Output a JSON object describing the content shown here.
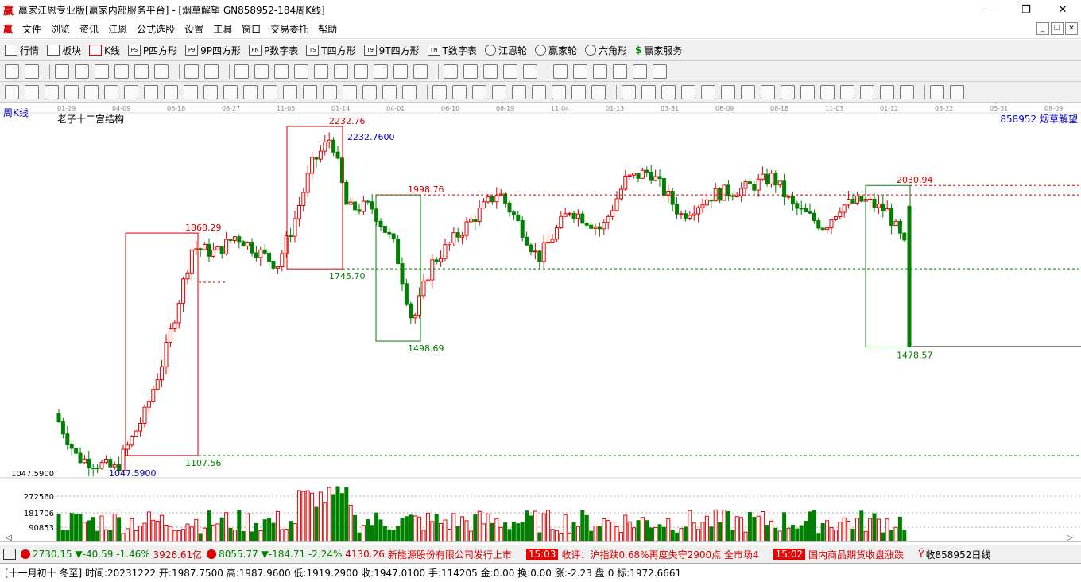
{
  "window": {
    "title": "赢家江恩专业版[赢家内部服务平台] - [烟草解望  GN858952-184周K线]",
    "logo": "赢"
  },
  "menu": [
    "文件",
    "浏览",
    "资讯",
    "江恩",
    "公式选股",
    "设置",
    "工具",
    "窗口",
    "交易委托",
    "帮助"
  ],
  "nav": [
    {
      "icon": "table-icon",
      "label": "行情"
    },
    {
      "icon": "grid-icon",
      "label": "板块"
    },
    {
      "icon": "candle-icon",
      "label": "K线"
    },
    {
      "icon": "ps-icon",
      "label": "P四方形"
    },
    {
      "icon": "9p-icon",
      "label": "9P四方形"
    },
    {
      "icon": "pn-icon",
      "label": "P数字表"
    },
    {
      "icon": "ts-icon",
      "label": "T四方形"
    },
    {
      "icon": "t9-icon",
      "label": "9T四方形"
    },
    {
      "icon": "tn-icon",
      "label": "T数字表"
    },
    {
      "icon": "wheel-icon",
      "label": "江恩轮"
    },
    {
      "icon": "wheel-icon",
      "label": "赢家轮"
    },
    {
      "icon": "hexagon-icon",
      "label": "六角形"
    },
    {
      "icon": "dollar-icon",
      "label": "赢家服务"
    }
  ],
  "chart_header": {
    "period_label": "周K线",
    "indicator_name": "老子十二宫结构",
    "code_name": "858952  烟草解望",
    "min_price_label": "1047.5900"
  },
  "chart_data": {
    "type": "candlestick",
    "x_ticks": [
      "01-29",
      "04-09",
      "06-18",
      "08-27",
      "11-05",
      "01-14",
      "04-01",
      "06-10",
      "08-19",
      "11-04",
      "01-13",
      "03-31",
      "06-09",
      "08-18",
      "11-03",
      "01-12",
      "03-22",
      "05-31",
      "08-09"
    ],
    "annotations": [
      "2232.76",
      "2232.7600",
      "1998.76",
      "1868.29",
      "1745.70",
      "1498.69",
      "1107.56",
      "1047.5900",
      "2030.94",
      "1478.57"
    ],
    "volume_axis": [
      "272560",
      "181706",
      "90853"
    ],
    "price_range": [
      1000,
      2300
    ]
  },
  "status": {
    "sh_index": "2730.15",
    "sh_change": "▼-40.59",
    "sh_pct": "-1.46%",
    "sh_amount": "3926.61亿",
    "sz_index": "8055.77",
    "sz_change": "▼-184.71",
    "sz_pct": "-2.24%",
    "sz_amount": "4130.26",
    "news1": "新能源股份有限公司发行上市",
    "time1": "15:03",
    "news2": "收评：沪指跌0.68%再度失守2900点 全市场4",
    "time2": "15:02",
    "news3": "国内商品期货收盘涨跌",
    "ticker": "收858952日线"
  },
  "info": {
    "text": "[十一月初十 冬至] 时间:20231222 开:1987.7500 高:1987.9600 低:1919.2900 收:1947.0100 手:114205 金:0.00 换:0.00 涨:-2.23 盘:0 标:1972.6661"
  }
}
